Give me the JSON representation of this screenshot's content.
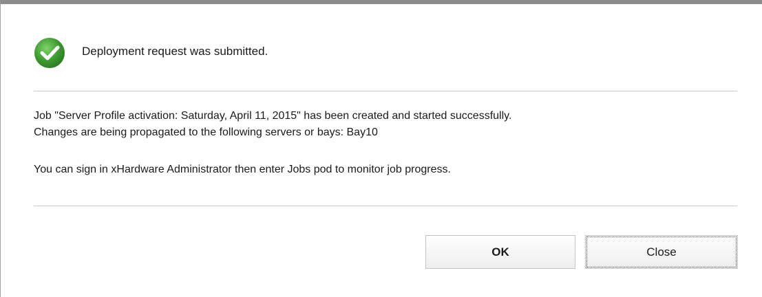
{
  "dialog": {
    "header": {
      "icon": "success-check-icon",
      "icon_color": "#3c9a2e",
      "text": "Deployment request was submitted."
    },
    "message": {
      "line1": "Job \"Server Profile activation: Saturday, April 11, 2015\" has been created and started successfully.",
      "line2": "Changes are being propagated to the following servers or bays: Bay10",
      "line3": "You can sign in xHardware Administrator then enter Jobs pod to monitor job progress."
    },
    "buttons": {
      "ok_label": "OK",
      "close_label": "Close"
    }
  }
}
